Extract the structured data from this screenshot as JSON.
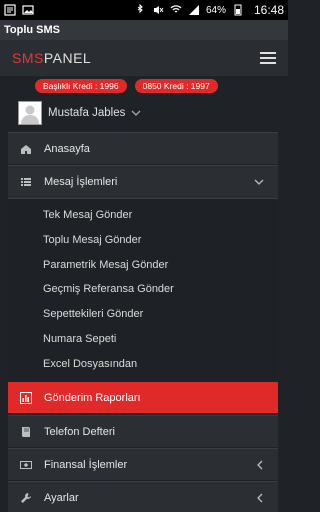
{
  "statusbar": {
    "battery": "64%",
    "time": "16:48"
  },
  "app": {
    "title": "Toplu SMS"
  },
  "header": {
    "brand_sms": "SMS",
    "brand_panel": "PANEL"
  },
  "credits": {
    "basikli": "Başlıklı Kredi : 1996",
    "numara": "0850 Kredi : 1997"
  },
  "user": {
    "name": "Mustafa Jables"
  },
  "menu": {
    "anasayfa": "Anasayfa",
    "mesaj": "Mesaj İşlemleri",
    "submenu": [
      "Tek Mesaj Gönder",
      "Toplu Mesaj Gönder",
      "Parametrik Mesaj Gönder",
      "Geçmiş Referansa Gönder",
      "Sepettekileri Gönder",
      "Numara Sepeti",
      "Excel Dosyasından"
    ],
    "raporlar": "Gönderim Raporları",
    "telefon": "Telefon Defteri",
    "finansal": "Finansal İşlemler",
    "ayarlar": "Ayarlar"
  },
  "colors": {
    "accent": "#e02a2a",
    "background": "#1f2226",
    "panel": "#2b2f33"
  }
}
